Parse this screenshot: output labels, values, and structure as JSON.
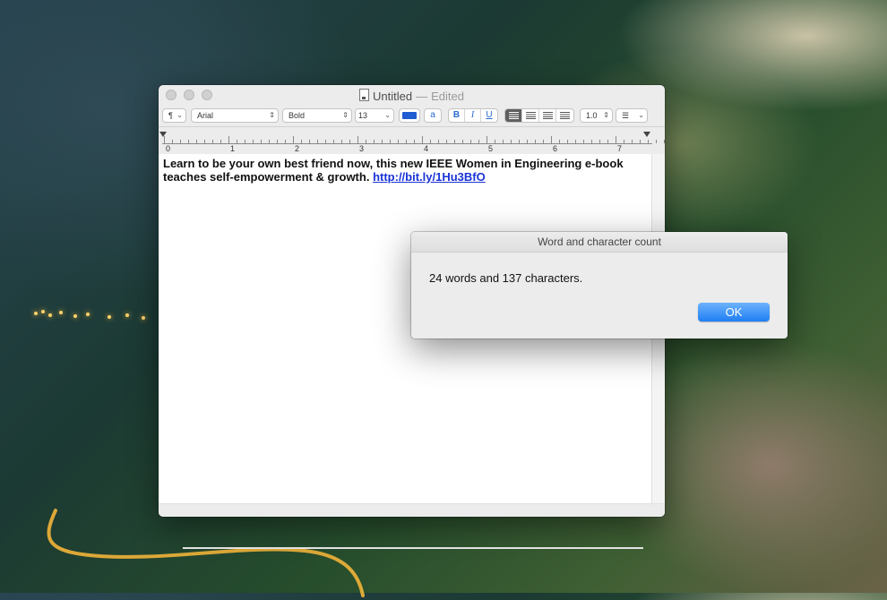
{
  "window": {
    "title": "Untitled",
    "separator": "—",
    "status": "Edited"
  },
  "toolbar": {
    "paragraph_symbol": "¶",
    "font_family": "Arial",
    "font_style": "Bold",
    "font_size": "13",
    "text_color": "#1f5bd1",
    "highlight_label": "a",
    "bold_label": "B",
    "italic_label": "I",
    "underline_label": "U",
    "line_spacing": "1.0"
  },
  "ruler": {
    "numbers": [
      "0",
      "1",
      "2",
      "3",
      "4",
      "5",
      "6",
      "7"
    ]
  },
  "document": {
    "text": "Learn to be your own best friend now, this new IEEE Women in Engineering e-book teaches self-empowerment & growth.",
    "link": "http://bit.ly/1Hu3BfO"
  },
  "dialog": {
    "title": "Word and character count",
    "message": "24 words and 137 characters.",
    "ok_label": "OK"
  },
  "colors": {
    "accent": "#1f7ef5",
    "link": "#1a33d6"
  }
}
